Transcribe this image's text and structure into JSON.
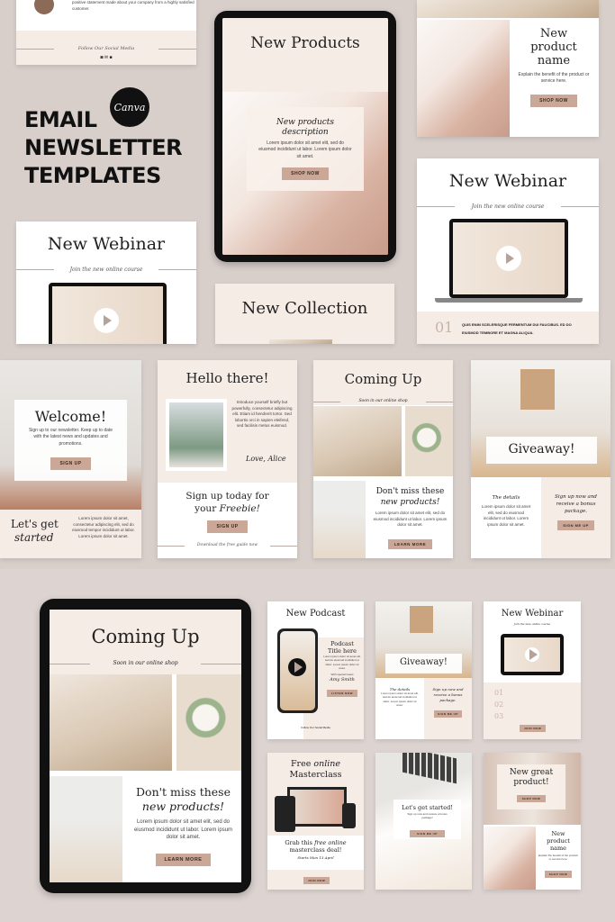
{
  "hero": {
    "line1": "EMAIL",
    "line2": "NEWSLETTER",
    "line3": "TEMPLATES",
    "brand_logo": "Canva"
  },
  "testimonial": {
    "text": "positive statement made about your company from a highly satisfied customer.",
    "footer": "Follow Our Social Media",
    "icons": [
      "instagram-icon",
      "mail-icon",
      "facebook-icon"
    ]
  },
  "new_products": {
    "title": "New Products",
    "subtitle": "New products description",
    "body": "Lorem ipsum dolor sit amet elit, sed do eiusmod incididunt ut labor. Lorem ipsum dolor sit amet.",
    "button": "SHOP NOW"
  },
  "product_card": {
    "title": "New product name",
    "body": "Explain the benefit of the product or service here.",
    "button": "SHOP NOW"
  },
  "webinar_right": {
    "title": "New Webinar",
    "subtitle": "Join the new online course",
    "number": "01",
    "text": "QUIS ENIM SCELERISQUE FERMENTUM DUI FAUCIBUS. ED DO EIUSMOD TEMBORE ET MAGNA ALIQUA."
  },
  "webinar_left": {
    "title": "New Webinar",
    "subtitle": "Join the new online course"
  },
  "collection": {
    "title": "New Collection"
  },
  "welcome": {
    "title": "Welcome!",
    "body": "Sign up to our newsletter. Keep up to date with the latest news and updates and promotions.",
    "button": "SIGN UP",
    "heading1": "Let's get",
    "heading2": "started",
    "body2": "Lorem ipsum dolor sit amet, consectetur adipiscing elit, sed do eiusmod tempor incididunt ut labor. Lorem ipsum dolor sit amet."
  },
  "hello": {
    "title": "Hello there!",
    "body": "Introduce yourself briefly but powerfully, consectetur adipiscing elit. Etiam id hendrerit tortor. Sed lobortis orci in sapien eleifend, sed facilisis metus euismod.",
    "signature": "Love, Alice",
    "cta1": "Sign up today for",
    "cta2": "your",
    "cta3": "Freebie!",
    "button": "SIGN UP",
    "footer": "Download the free guide now"
  },
  "coming_up": {
    "title": "Coming Up",
    "subtitle": "Soon in our online shop",
    "heading1": "Don't miss these",
    "heading2": "new products!",
    "body": "Lorem ipsum dolor sit amet elit, sed do eiusmod incididunt ut labor. Lorem ipsum dolor sit amet.",
    "button": "LEARN MORE"
  },
  "giveaway": {
    "title": "Giveaway!",
    "details_title": "The details",
    "details_body": "Lorem ipsum dolor sit amet elit, sed do eiusmod incididunt ut labor. Lorem ipsum dolor sit amet.",
    "cta": "Sign up now and receive a bonus package.",
    "button": "SIGN ME UP"
  },
  "podcast": {
    "title": "New Podcast",
    "subtitle": "Podcast Title here",
    "body": "Lorem ipsum dolor sit amet elit, sed do eiusmod incididunt ut labor. Lorem ipsum dolor sit amet.",
    "guest": "With special Guest",
    "signature": "Amy Smith",
    "button": "LISTEN NOW",
    "footer": "Follow Our Social Media"
  },
  "webinar_small": {
    "title": "New Webinar",
    "subtitle": "Join the new online course",
    "items": [
      "01",
      "02",
      "03"
    ],
    "button": "JOIN NOW"
  },
  "masterclass": {
    "title1": "Free",
    "title2": "online",
    "title3": "Masterclass",
    "cta1": "Grab this",
    "cta2": "free online",
    "cta3": "masterclass deal!",
    "signature": "Starts Mon 13 April",
    "button": "JOIN NOW"
  },
  "started": {
    "title": "Let's get started!",
    "body": "Sign up now and receive a bonus package!",
    "button": "SIGN ME UP"
  },
  "great_product": {
    "title": "New great product!",
    "button": "SHOP NOW",
    "name": "New product name",
    "body": "Explain the benefit of the product or service here.",
    "button2": "SHOP NOW"
  }
}
